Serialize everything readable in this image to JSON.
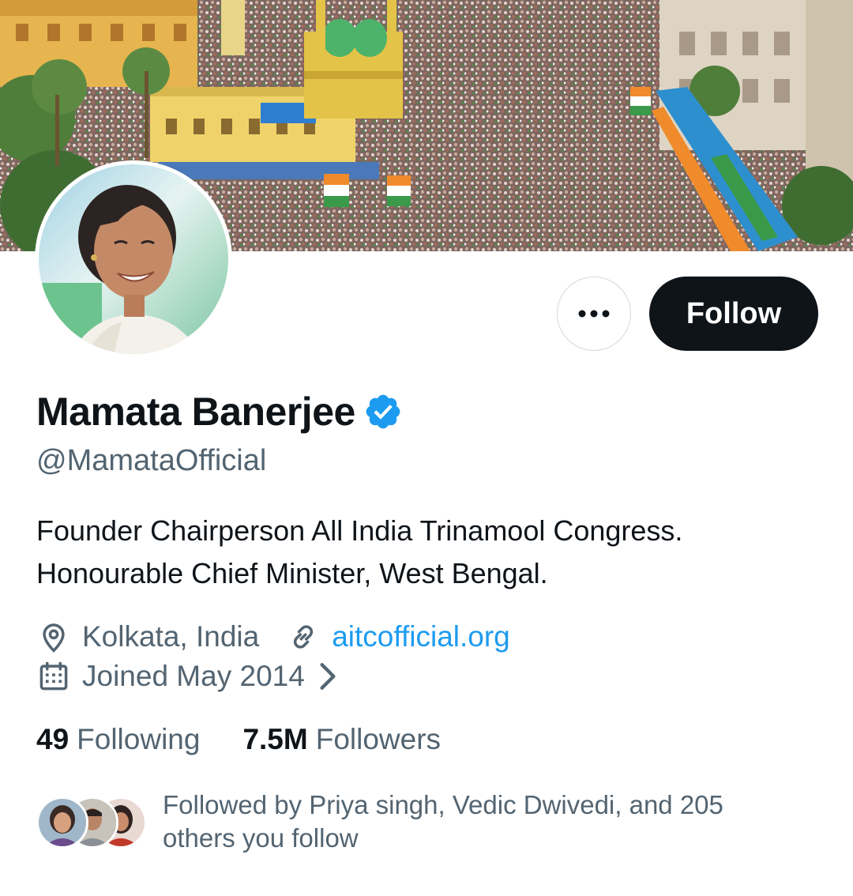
{
  "profile": {
    "display_name": "Mamata Banerjee",
    "handle": "@MamataOfficial",
    "verified": true,
    "bio_lines": [
      "Founder Chairperson All India Trinamool Congress.",
      "Honourable Chief Minister, West Bengal."
    ],
    "location": "Kolkata, India",
    "website": "aitcofficial.org",
    "joined": "Joined May 2014"
  },
  "actions": {
    "more_icon": "ellipsis-icon",
    "follow_label": "Follow"
  },
  "stats": {
    "following_count": "49",
    "following_label": "Following",
    "followers_count": "7.5M",
    "followers_label": "Followers"
  },
  "followed_by": {
    "line1": "Followed by Priya singh, Vedic Dwivedi, and 205",
    "line2": "others you follow"
  },
  "icons": {
    "verified": "verified-badge-icon",
    "location": "location-pin-icon",
    "link": "link-icon",
    "calendar": "calendar-icon",
    "chevron": "chevron-right-icon"
  },
  "colors": {
    "text_primary": "#0f1419",
    "text_secondary": "#536471",
    "link": "#1d9bf0",
    "verified": "#1d9bf0",
    "follow_button_bg": "#0f1419",
    "follow_button_text": "#ffffff",
    "border": "#cfd9de"
  }
}
